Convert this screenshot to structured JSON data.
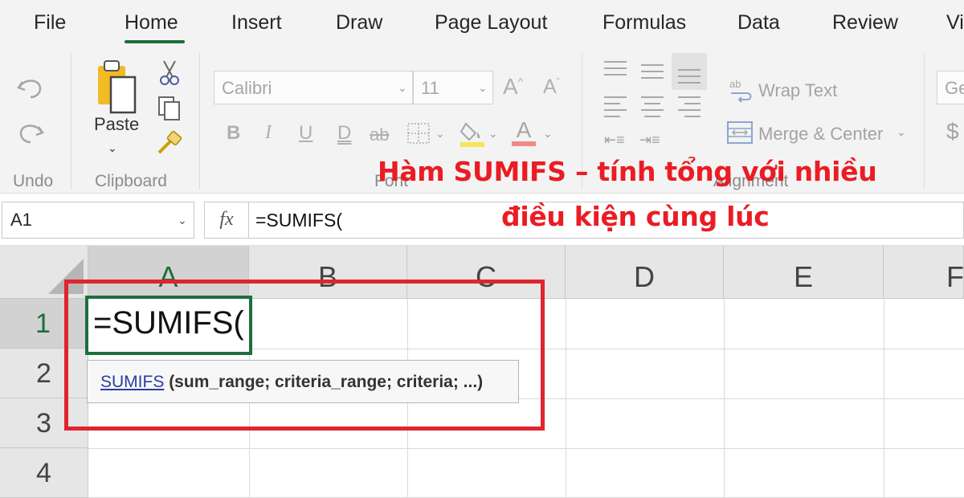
{
  "tabs": [
    "File",
    "Home",
    "Insert",
    "Draw",
    "Page Layout",
    "Formulas",
    "Data",
    "Review",
    "Vi"
  ],
  "active_tab": "Home",
  "ribbon": {
    "undo_group_label": "Undo",
    "paste_label": "Paste",
    "clipboard_group_label": "Clipboard",
    "font_group_label": "Font",
    "alignment_group_label": "Alignment",
    "font_name": "Calibri",
    "font_size": "11",
    "wrap_text_label": "Wrap Text",
    "merge_center_label": "Merge & Center",
    "number_format": "Ge",
    "currency_symbol": "$"
  },
  "formula_bar": {
    "name_box": "A1",
    "fx_label": "fx",
    "formula": "=SUMIFS("
  },
  "grid": {
    "columns": [
      "A",
      "B",
      "C",
      "D",
      "E",
      "F"
    ],
    "rows": [
      "1",
      "2",
      "3",
      "4"
    ],
    "active_cell_value": "=SUMIFS("
  },
  "tooltip": {
    "function_link": "SUMIFS",
    "arguments": "(sum_range; criteria_range; criteria; ...)"
  },
  "caption": {
    "line1": "Hàm SUMIFS – tính tổng với nhiều",
    "line2": "điều kiện cùng lúc"
  },
  "colors": {
    "accent_green": "#1e6f3c",
    "highlight_red": "#e0252e",
    "caption_red": "#ea1c24",
    "link_blue": "#2b3da3"
  },
  "icons": {
    "undo": "undo-icon",
    "redo": "redo-icon",
    "paste": "paste-icon",
    "cut": "scissors-icon",
    "copy": "copy-icon",
    "format_painter": "format-painter-icon",
    "wrap": "wrap-text-icon",
    "merge": "merge-center-icon"
  }
}
